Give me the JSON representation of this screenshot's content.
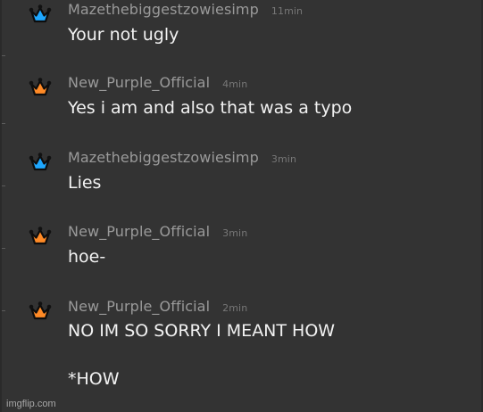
{
  "colors": {
    "background": "#333333",
    "username": "#9a9a9a",
    "timestamp": "#777777",
    "message_text": "#f2f2f2",
    "crown_blue": "#1ea7ff",
    "crown_orange": "#ff8a26"
  },
  "messages": [
    {
      "username": "Mazethebiggestzowiesimp",
      "time": "11min",
      "crown_icon": "blue-crown-icon",
      "lines": [
        "Your not ugly"
      ]
    },
    {
      "username": "New_Purple_Official",
      "time": "4min",
      "crown_icon": "orange-crown-icon",
      "lines": [
        "Yes i am and also that was a typo"
      ]
    },
    {
      "username": "Mazethebiggestzowiesimp",
      "time": "3min",
      "crown_icon": "blue-crown-icon",
      "lines": [
        "Lies"
      ]
    },
    {
      "username": "New_Purple_Official",
      "time": "3min",
      "crown_icon": "orange-crown-icon",
      "lines": [
        "hoe-"
      ]
    },
    {
      "username": "New_Purple_Official",
      "time": "2min",
      "crown_icon": "orange-crown-icon",
      "lines": [
        "NO IM SO SORRY I MEANT HOW",
        "*HOW"
      ]
    }
  ],
  "watermark": "imgflip.com"
}
